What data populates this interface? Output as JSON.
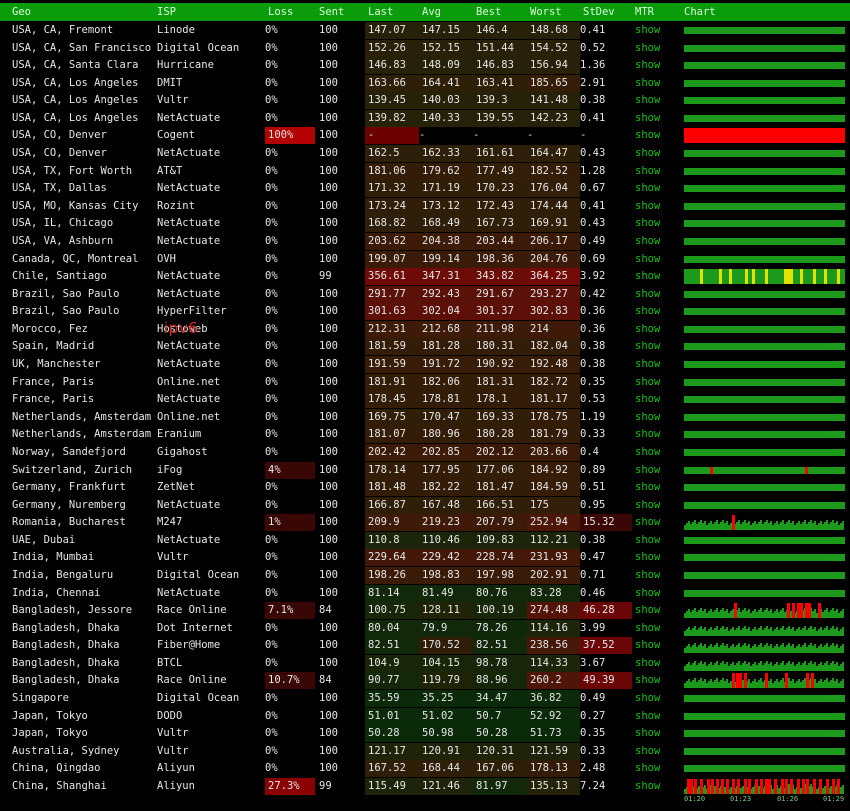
{
  "columns": [
    "Geo",
    "ISP",
    "Loss",
    "Sent",
    "Last",
    "Avg",
    "Best",
    "Worst",
    "StDev",
    "MTR",
    "Chart"
  ],
  "show_label": "show",
  "annotation": "ipv6",
  "tick_labels": [
    "01:20",
    "01:23",
    "01:26",
    "01:29"
  ],
  "colors": {
    "header_bg": "#0b9c0b",
    "ok": "#1b9a1b",
    "loss": "#ff0000",
    "jitter": "#e2e200",
    "link": "#19c419"
  },
  "rows": [
    {
      "geo": "USA, CA, Fremont",
      "isp": "Linode",
      "loss": "0%",
      "sent": "100",
      "last": "147.07",
      "avg": "147.15",
      "best": "146.4",
      "worst": "148.68",
      "stdev": "0.41"
    },
    {
      "geo": "USA, CA, San Francisco",
      "isp": "Digital Ocean",
      "loss": "0%",
      "sent": "100",
      "last": "152.26",
      "avg": "152.15",
      "best": "151.44",
      "worst": "154.52",
      "stdev": "0.52"
    },
    {
      "geo": "USA, CA, Santa Clara",
      "isp": "Hurricane",
      "loss": "0%",
      "sent": "100",
      "last": "146.83",
      "avg": "148.09",
      "best": "146.83",
      "worst": "156.94",
      "stdev": "1.36"
    },
    {
      "geo": "USA, CA, Los Angeles",
      "isp": "DMIT",
      "loss": "0%",
      "sent": "100",
      "last": "163.66",
      "avg": "164.41",
      "best": "163.41",
      "worst": "185.65",
      "stdev": "2.91"
    },
    {
      "geo": "USA, CA, Los Angeles",
      "isp": "Vultr",
      "loss": "0%",
      "sent": "100",
      "last": "139.45",
      "avg": "140.03",
      "best": "139.3",
      "worst": "141.48",
      "stdev": "0.38"
    },
    {
      "geo": "USA, CA, Los Angeles",
      "isp": "NetActuate",
      "loss": "0%",
      "sent": "100",
      "last": "139.82",
      "avg": "140.33",
      "best": "139.55",
      "worst": "142.23",
      "stdev": "0.41"
    },
    {
      "geo": "USA, CO, Denver",
      "isp": "Cogent",
      "loss": "100%",
      "sent": "100",
      "last": "-",
      "avg": "-",
      "best": "-",
      "worst": "-",
      "stdev": "-",
      "down": true
    },
    {
      "geo": "USA, CO, Denver",
      "isp": "NetActuate",
      "loss": "0%",
      "sent": "100",
      "last": "162.5",
      "avg": "162.33",
      "best": "161.61",
      "worst": "164.47",
      "stdev": "0.43"
    },
    {
      "geo": "USA, TX, Fort Worth",
      "isp": "AT&T",
      "loss": "0%",
      "sent": "100",
      "last": "181.06",
      "avg": "179.62",
      "best": "177.49",
      "worst": "182.52",
      "stdev": "1.28"
    },
    {
      "geo": "USA, TX, Dallas",
      "isp": "NetActuate",
      "loss": "0%",
      "sent": "100",
      "last": "171.32",
      "avg": "171.19",
      "best": "170.23",
      "worst": "176.04",
      "stdev": "0.67"
    },
    {
      "geo": "USA, MO, Kansas City",
      "isp": "Rozint",
      "loss": "0%",
      "sent": "100",
      "last": "173.24",
      "avg": "173.12",
      "best": "172.43",
      "worst": "174.44",
      "stdev": "0.41"
    },
    {
      "geo": "USA, IL, Chicago",
      "isp": "NetActuate",
      "loss": "0%",
      "sent": "100",
      "last": "168.82",
      "avg": "168.49",
      "best": "167.73",
      "worst": "169.91",
      "stdev": "0.43"
    },
    {
      "geo": "USA, VA, Ashburn",
      "isp": "NetActuate",
      "loss": "0%",
      "sent": "100",
      "last": "203.62",
      "avg": "204.38",
      "best": "203.44",
      "worst": "206.17",
      "stdev": "0.49"
    },
    {
      "geo": "Canada, QC, Montreal",
      "isp": "OVH",
      "loss": "0%",
      "sent": "100",
      "last": "199.07",
      "avg": "199.14",
      "best": "198.36",
      "worst": "204.76",
      "stdev": "0.69"
    },
    {
      "geo": "Chile, Santiago",
      "isp": "NetActuate",
      "loss": "0%",
      "sent": "99",
      "last": "356.61",
      "avg": "347.31",
      "best": "343.82",
      "worst": "364.25",
      "stdev": "3.92",
      "jitter": true
    },
    {
      "geo": "Brazil, Sao Paulo",
      "isp": "NetActuate",
      "loss": "0%",
      "sent": "100",
      "last": "291.77",
      "avg": "292.43",
      "best": "291.67",
      "worst": "293.27",
      "stdev": "0.42"
    },
    {
      "geo": "Brazil, Sao Paulo",
      "isp": "HyperFilter",
      "loss": "0%",
      "sent": "100",
      "last": "301.63",
      "avg": "302.04",
      "best": "301.37",
      "worst": "302.83",
      "stdev": "0.36"
    },
    {
      "geo": "Morocco, Fez",
      "isp": "Hostoweb",
      "loss": "0%",
      "sent": "100",
      "last": "212.31",
      "avg": "212.68",
      "best": "211.98",
      "worst": "214",
      "stdev": "0.36"
    },
    {
      "geo": "Spain, Madrid",
      "isp": "NetActuate",
      "loss": "0%",
      "sent": "100",
      "last": "181.59",
      "avg": "181.28",
      "best": "180.31",
      "worst": "182.04",
      "stdev": "0.38"
    },
    {
      "geo": "UK, Manchester",
      "isp": "NetActuate",
      "loss": "0%",
      "sent": "100",
      "last": "191.59",
      "avg": "191.72",
      "best": "190.92",
      "worst": "192.48",
      "stdev": "0.38"
    },
    {
      "geo": "France, Paris",
      "isp": "Online.net",
      "loss": "0%",
      "sent": "100",
      "last": "181.91",
      "avg": "182.06",
      "best": "181.31",
      "worst": "182.72",
      "stdev": "0.35"
    },
    {
      "geo": "France, Paris",
      "isp": "NetActuate",
      "loss": "0%",
      "sent": "100",
      "last": "178.45",
      "avg": "178.81",
      "best": "178.1",
      "worst": "181.17",
      "stdev": "0.53"
    },
    {
      "geo": "Netherlands, Amsterdam",
      "isp": "Online.net",
      "loss": "0%",
      "sent": "100",
      "last": "169.75",
      "avg": "170.47",
      "best": "169.33",
      "worst": "178.75",
      "stdev": "1.19"
    },
    {
      "geo": "Netherlands, Amsterdam",
      "isp": "Eranium",
      "loss": "0%",
      "sent": "100",
      "last": "181.07",
      "avg": "180.96",
      "best": "180.28",
      "worst": "181.79",
      "stdev": "0.33"
    },
    {
      "geo": "Norway, Sandefjord",
      "isp": "Gigahost",
      "loss": "0%",
      "sent": "100",
      "last": "202.42",
      "avg": "202.85",
      "best": "202.12",
      "worst": "203.66",
      "stdev": "0.4"
    },
    {
      "geo": "Switzerland, Zurich",
      "isp": "iFog",
      "loss": "4%",
      "sent": "100",
      "last": "178.14",
      "avg": "177.95",
      "best": "177.06",
      "worst": "184.92",
      "stdev": "0.89",
      "marks": [
        0.16,
        0.75
      ]
    },
    {
      "geo": "Germany, Frankfurt",
      "isp": "ZetNet",
      "loss": "0%",
      "sent": "100",
      "last": "181.48",
      "avg": "182.22",
      "best": "181.47",
      "worst": "184.59",
      "stdev": "0.51"
    },
    {
      "geo": "Germany, Nuremberg",
      "isp": "NetActuate",
      "loss": "0%",
      "sent": "100",
      "last": "166.87",
      "avg": "167.48",
      "best": "166.51",
      "worst": "175",
      "stdev": "0.95"
    },
    {
      "geo": "Romania, Bucharest",
      "isp": "M247",
      "loss": "1%",
      "sent": "100",
      "last": "209.9",
      "avg": "219.23",
      "best": "207.79",
      "worst": "252.94",
      "stdev": "15.32",
      "marks": [
        0.3
      ],
      "wavy": true
    },
    {
      "geo": "UAE, Dubai",
      "isp": "NetActuate",
      "loss": "0%",
      "sent": "100",
      "last": "110.8",
      "avg": "110.46",
      "best": "109.83",
      "worst": "112.21",
      "stdev": "0.38"
    },
    {
      "geo": "India, Mumbai",
      "isp": "Vultr",
      "loss": "0%",
      "sent": "100",
      "last": "229.64",
      "avg": "229.42",
      "best": "228.74",
      "worst": "231.93",
      "stdev": "0.47"
    },
    {
      "geo": "India, Bengaluru",
      "isp": "Digital Ocean",
      "loss": "0%",
      "sent": "100",
      "last": "198.26",
      "avg": "198.83",
      "best": "197.98",
      "worst": "202.91",
      "stdev": "0.71"
    },
    {
      "geo": "India, Chennai",
      "isp": "NetActuate",
      "loss": "0%",
      "sent": "100",
      "last": "81.14",
      "avg": "81.49",
      "best": "80.76",
      "worst": "83.28",
      "stdev": "0.46"
    },
    {
      "geo": "Bangladesh, Jessore",
      "isp": "Race Online",
      "loss": "7.1%",
      "sent": "84",
      "last": "100.75",
      "avg": "128.11",
      "best": "100.19",
      "worst": "274.48",
      "stdev": "46.28",
      "marks": [
        0.31,
        0.64,
        0.67,
        0.7,
        0.72,
        0.75,
        0.77,
        0.83
      ],
      "wavy": true
    },
    {
      "geo": "Bangladesh, Dhaka",
      "isp": "Dot Internet",
      "loss": "0%",
      "sent": "100",
      "last": "80.04",
      "avg": "79.9",
      "best": "78.26",
      "worst": "114.16",
      "stdev": "3.99",
      "wavy": true
    },
    {
      "geo": "Bangladesh, Dhaka",
      "isp": "Fiber@Home",
      "loss": "0%",
      "sent": "100",
      "last": "82.51",
      "avg": "170.52",
      "best": "82.51",
      "worst": "238.56",
      "stdev": "37.52",
      "wavy": true
    },
    {
      "geo": "Bangladesh, Dhaka",
      "isp": "BTCL",
      "loss": "0%",
      "sent": "100",
      "last": "104.9",
      "avg": "104.15",
      "best": "98.78",
      "worst": "114.33",
      "stdev": "3.67",
      "wavy": true
    },
    {
      "geo": "Bangladesh, Dhaka",
      "isp": "Race Online",
      "loss": "10.7%",
      "sent": "84",
      "last": "90.77",
      "avg": "119.79",
      "best": "88.96",
      "worst": "260.2",
      "stdev": "49.39",
      "marks": [
        0.3,
        0.32,
        0.34,
        0.37,
        0.5,
        0.63,
        0.76,
        0.79
      ],
      "wavy": true
    },
    {
      "geo": "Singapore",
      "isp": "Digital Ocean",
      "loss": "0%",
      "sent": "100",
      "last": "35.59",
      "avg": "35.25",
      "best": "34.47",
      "worst": "36.82",
      "stdev": "0.49"
    },
    {
      "geo": "Japan, Tokyo",
      "isp": "DODO",
      "loss": "0%",
      "sent": "100",
      "last": "51.01",
      "avg": "51.02",
      "best": "50.7",
      "worst": "52.92",
      "stdev": "0.27"
    },
    {
      "geo": "Japan, Tokyo",
      "isp": "Vultr",
      "loss": "0%",
      "sent": "100",
      "last": "50.28",
      "avg": "50.98",
      "best": "50.28",
      "worst": "51.73",
      "stdev": "0.35"
    },
    {
      "geo": "Australia, Sydney",
      "isp": "Vultr",
      "loss": "0%",
      "sent": "100",
      "last": "121.17",
      "avg": "120.91",
      "best": "120.31",
      "worst": "121.59",
      "stdev": "0.33"
    },
    {
      "geo": "China, Qingdao",
      "isp": "Aliyun",
      "loss": "0%",
      "sent": "100",
      "last": "167.52",
      "avg": "168.44",
      "best": "167.06",
      "worst": "178.13",
      "stdev": "2.48"
    },
    {
      "geo": "China, Shanghai",
      "isp": "Aliyun",
      "loss": "27.3%",
      "sent": "99",
      "last": "115.49",
      "avg": "121.46",
      "best": "81.97",
      "worst": "135.13",
      "stdev": "7.24",
      "marks": [
        0.02,
        0.04,
        0.06,
        0.1,
        0.14,
        0.17,
        0.2,
        0.23,
        0.26,
        0.3,
        0.33,
        0.37,
        0.4,
        0.44,
        0.47,
        0.5,
        0.52,
        0.56,
        0.6,
        0.63,
        0.66,
        0.7,
        0.73,
        0.76,
        0.8,
        0.84,
        0.88,
        0.92,
        0.95
      ],
      "wavy": true
    }
  ]
}
